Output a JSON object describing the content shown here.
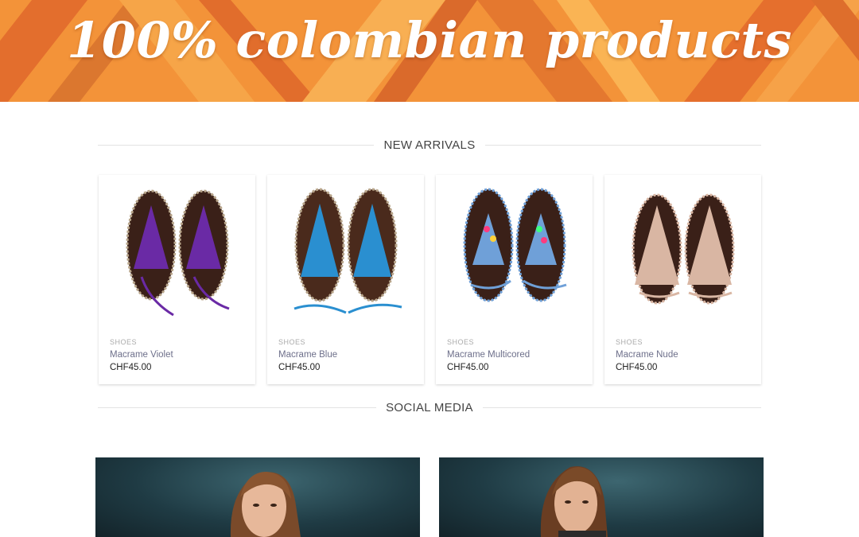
{
  "banner": {
    "title": "100% colombian products"
  },
  "sections": {
    "new_arrivals": "NEW ARRIVALS",
    "social_media": "SOCIAL MEDIA"
  },
  "products": [
    {
      "category": "SHOES",
      "name": "Macrame Violet",
      "price": "CHF45.00",
      "color": "#6a2aa5",
      "accent": "#8b3fc4"
    },
    {
      "category": "SHOES",
      "name": "Macrame Blue",
      "price": "CHF45.00",
      "color": "#2a8fd0",
      "accent": "#4fb3ea"
    },
    {
      "category": "SHOES",
      "name": "Macrame Multicored",
      "price": "CHF45.00",
      "color": "#6fa0d8",
      "accent": "#ff3b7f"
    },
    {
      "category": "SHOES",
      "name": "Macrame Nude",
      "price": "CHF45.00",
      "color": "#d9b6a3",
      "accent": "#ecd2c3"
    }
  ]
}
